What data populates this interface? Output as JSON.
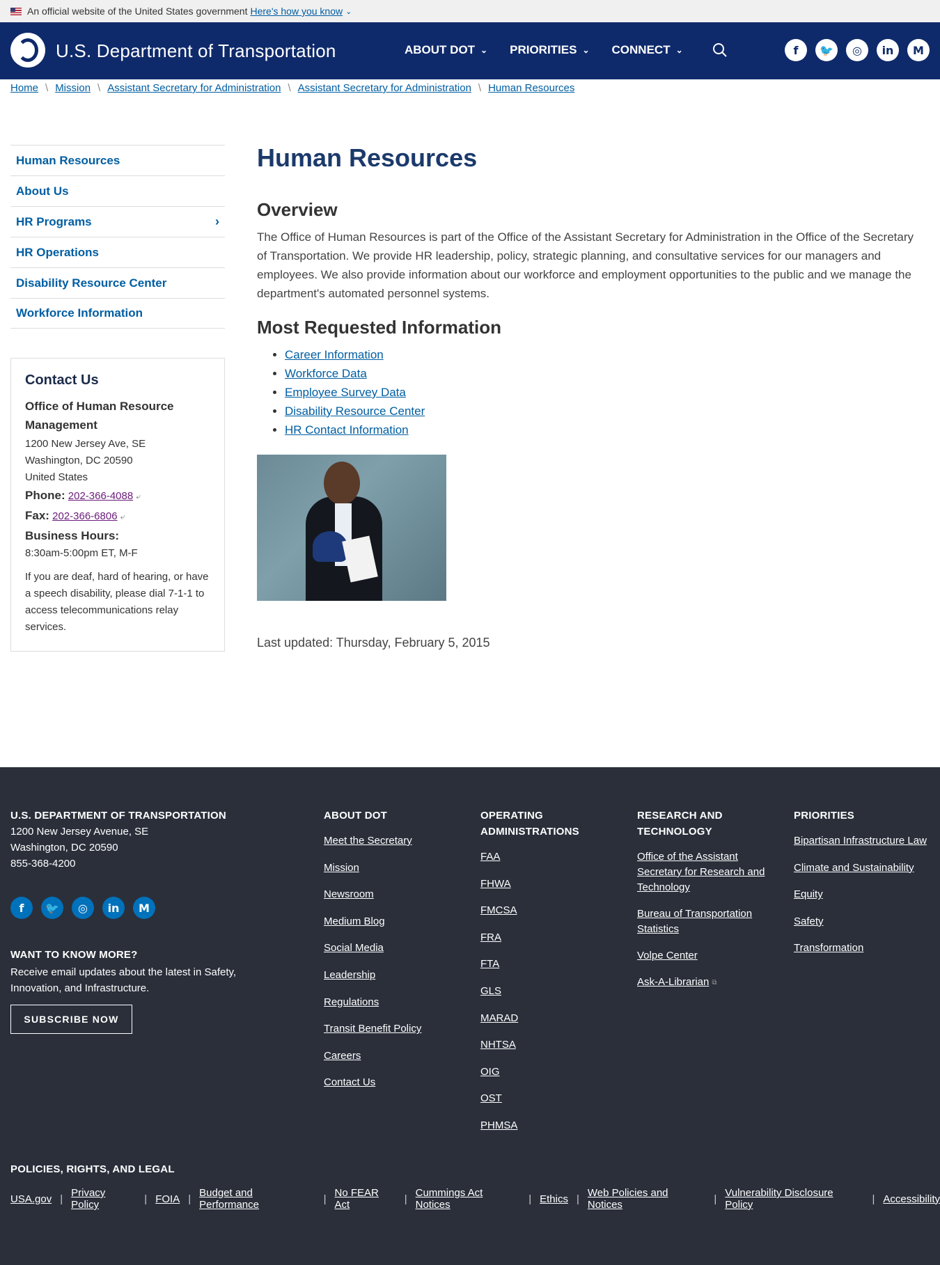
{
  "gov_banner": {
    "text": "An official website of the United States government",
    "link": "Here's how you know"
  },
  "header": {
    "logo_text": "U.S. Department of Transportation",
    "nav": [
      "ABOUT DOT",
      "PRIORITIES",
      "CONNECT"
    ],
    "social": [
      "f",
      "t",
      "ig",
      "in",
      "M"
    ]
  },
  "breadcrumb": [
    "Home",
    "Mission",
    "Assistant Secretary for Administration",
    "Assistant Secretary for Administration",
    "Human Resources"
  ],
  "side_nav": [
    {
      "label": "Human Resources"
    },
    {
      "label": "About Us"
    },
    {
      "label": "HR Programs",
      "chevron": "›"
    },
    {
      "label": "HR Operations"
    },
    {
      "label": "Disability Resource Center"
    },
    {
      "label": "Workforce Information"
    }
  ],
  "contact": {
    "title": "Contact Us",
    "office": "Office of Human Resource Management",
    "address1": "1200 New Jersey Ave, SE",
    "address2": "Washington, DC 20590",
    "address3": "United States",
    "phone_label": "Phone:",
    "phone": "202-366-4088",
    "fax_label": "Fax:",
    "fax": "202-366-6806",
    "hours_label": "Business Hours:",
    "hours": "8:30am-5:00pm ET, M-F",
    "tty": "If you are deaf, hard of hearing, or have a speech disability, please dial 7-1-1 to access telecommunications relay services."
  },
  "main": {
    "title": "Human Resources",
    "overview_heading": "Overview",
    "overview": "The Office of Human Resources is part of the Office of the Assistant Secretary for Administration in the Office of the Secretary of Transportation. We provide HR leadership, policy, strategic planning, and consultative services for our managers and employees. We also provide information about our workforce and employment opportunities to the public and we manage the department's automated personnel systems.",
    "requested_heading": "Most Requested Information",
    "requested_links": [
      "Career Information",
      "Workforce Data",
      "Employee Survey Data",
      "Disability Resource Center",
      "HR Contact Information"
    ],
    "last_updated": "Last updated: Thursday, February 5, 2015"
  },
  "footer": {
    "org": "U.S. DEPARTMENT OF TRANSPORTATION",
    "address1": "1200 New Jersey Avenue, SE",
    "address2": "Washington, DC 20590",
    "phone": "855-368-4200",
    "want_title": "WANT TO KNOW MORE?",
    "want_desc": "Receive email updates about the latest in Safety, Innovation, and Infrastructure.",
    "subscribe": "SUBSCRIBE NOW",
    "about_head": "ABOUT DOT",
    "about_links": [
      "Meet the Secretary",
      "Mission",
      "Newsroom",
      "Medium Blog",
      "Social Media",
      "Leadership",
      "Regulations",
      "Transit Benefit Policy",
      "Careers",
      "Contact Us"
    ],
    "opadmin_head": "OPERATING ADMINISTRATIONS",
    "opadmin_links": [
      "FAA",
      "FHWA",
      "FMCSA",
      "FRA",
      "FTA",
      "GLS",
      "MARAD",
      "NHTSA",
      "OIG",
      "OST",
      "PHMSA"
    ],
    "research_head": "RESEARCH AND TECHNOLOGY",
    "research_links": [
      "Office of the Assistant Secretary for Research and Technology",
      "Bureau of Transportation Statistics",
      "Volpe Center",
      "Ask-A-Librarian"
    ],
    "priorities_head": "PRIORITIES",
    "priorities_links": [
      "Bipartisan Infrastructure Law",
      "Climate and Sustainability",
      "Equity",
      "Safety",
      "Transformation"
    ],
    "policies_head": "POLICIES, RIGHTS, AND LEGAL",
    "policies_links": [
      "USA.gov",
      "Privacy Policy",
      "FOIA",
      "Budget and Performance",
      "No FEAR Act",
      "Cummings Act Notices",
      "Ethics",
      "Web Policies and Notices",
      "Vulnerability Disclosure Policy",
      "Accessibility"
    ]
  },
  "colors": {
    "header_bg": "#0f2a6b",
    "footer_bg": "#2a2f3a",
    "link": "#005ea2",
    "title": "#1b3a6b"
  }
}
